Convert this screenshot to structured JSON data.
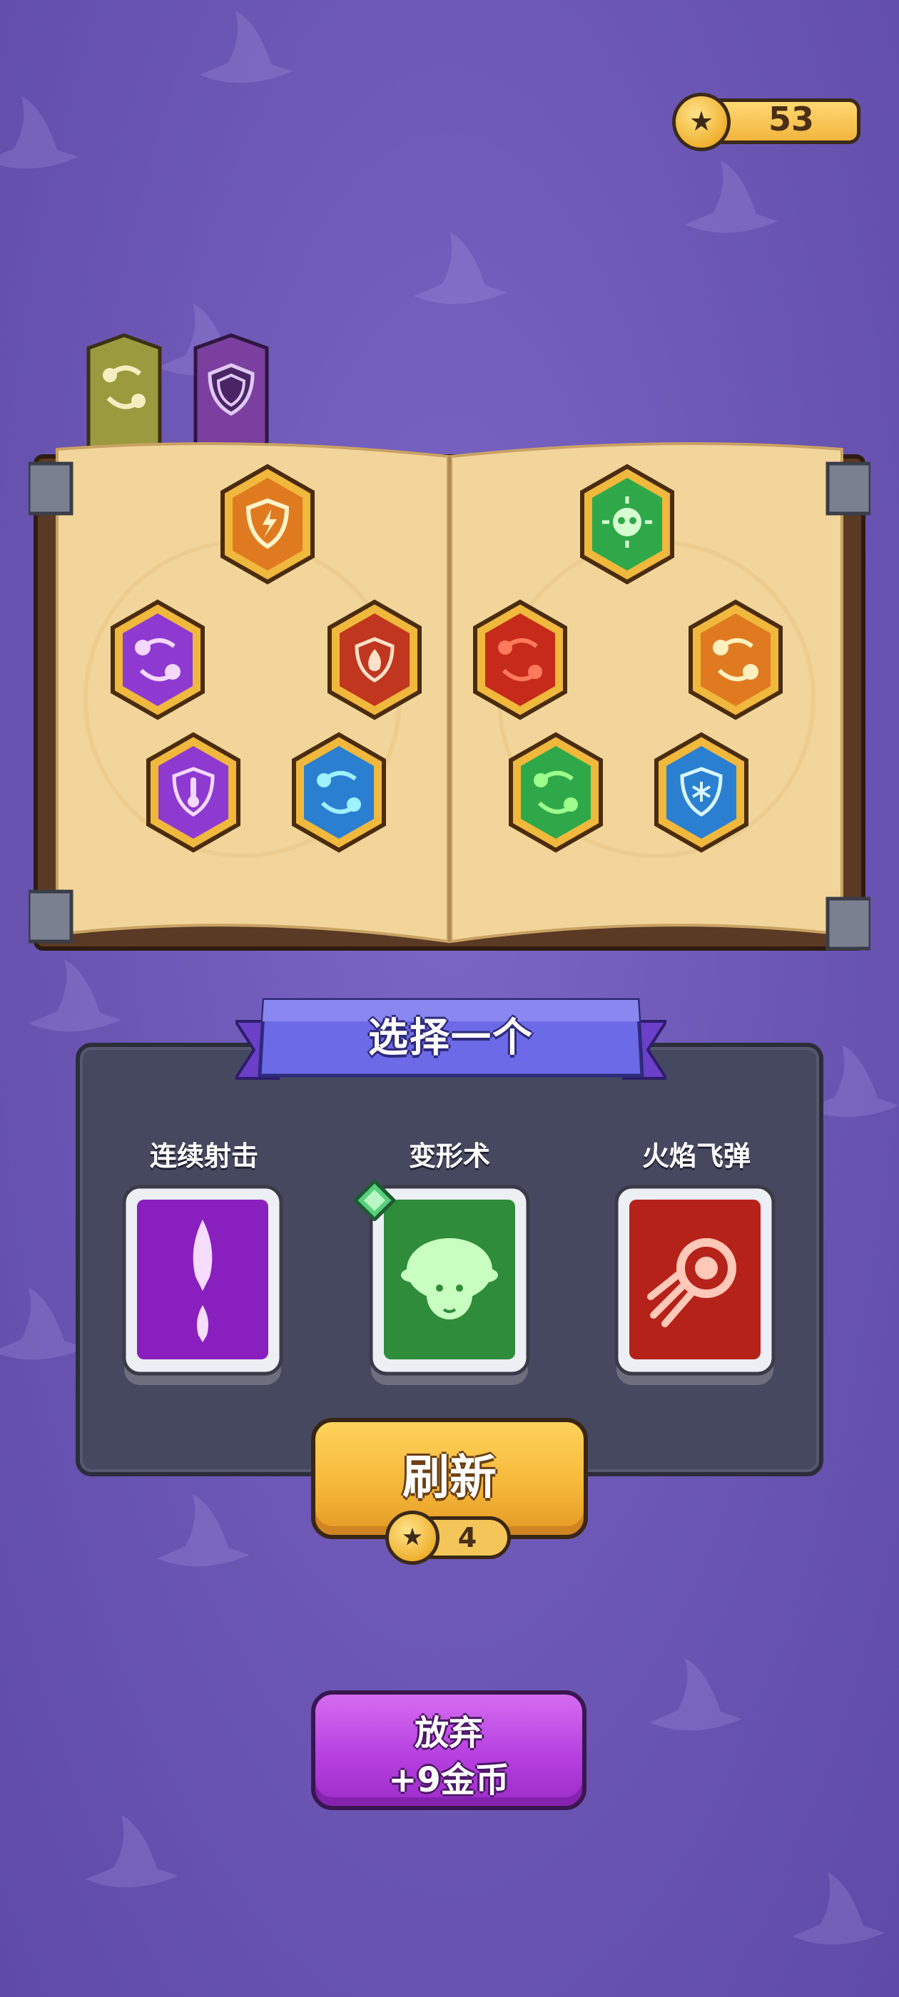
{
  "hud": {
    "coins": "53",
    "coin_icon": "star-coin-icon"
  },
  "book": {
    "tabs": [
      {
        "icon": "swap-orbs-icon",
        "color": "#9b9a3e",
        "selected": true
      },
      {
        "icon": "shield-icon",
        "color": "#7b3fa0",
        "selected": false
      }
    ],
    "skills": [
      {
        "icon": "lightning-shield-icon",
        "color": "#e07a20"
      },
      {
        "icon": "skull-burst-icon",
        "color": "#2fa84a"
      },
      {
        "icon": "purple-orbs-icon",
        "color": "#8e3ad0"
      },
      {
        "icon": "fire-shield-icon",
        "color": "#c0361e"
      },
      {
        "icon": "red-orbs-icon",
        "color": "#c52a1a"
      },
      {
        "icon": "orange-orbs-icon",
        "color": "#e07a20"
      },
      {
        "icon": "thermometer-shield-icon",
        "color": "#8e3ad0"
      },
      {
        "icon": "blue-orbs-icon",
        "color": "#2a7fd0"
      },
      {
        "icon": "green-orbs-icon",
        "color": "#2fa84a"
      },
      {
        "icon": "frost-shield-icon",
        "color": "#2a7fd0"
      }
    ]
  },
  "choice": {
    "title": "选择一个",
    "options": [
      {
        "name": "连续射击",
        "icon": "multi-shot-icon",
        "color": "#8a1fc0",
        "new": false
      },
      {
        "name": "变形术",
        "icon": "sheep-icon",
        "color": "#2f8c3a",
        "new": true
      },
      {
        "name": "火焰飞弹",
        "icon": "fireball-icon",
        "color": "#b5221a",
        "new": false
      }
    ]
  },
  "refresh": {
    "label": "刷新",
    "cost": "4"
  },
  "abandon": {
    "line1": "放弃",
    "line2": "+9金币"
  }
}
